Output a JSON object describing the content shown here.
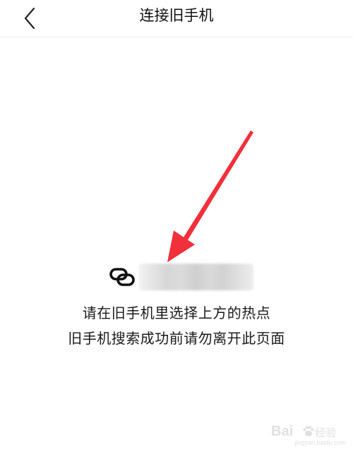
{
  "header": {
    "title": "连接旧手机",
    "back_icon": "chevron-left-icon"
  },
  "hotspot": {
    "icon": "link-icon",
    "name": ""
  },
  "instructions": {
    "line1": "请在旧手机里选择上方的热点",
    "line2": "旧手机搜索成功前请勿离开此页面"
  },
  "annotation": {
    "type": "red-arrow",
    "color": "#f0303a"
  },
  "watermark": {
    "brand": "Bai",
    "brand_suffix": "经验",
    "url": "jingyan.baidu.com"
  },
  "colors": {
    "background": "#ffffff",
    "text": "#1a1a1a",
    "divider": "#ececec",
    "arrow": "#f0303a"
  }
}
